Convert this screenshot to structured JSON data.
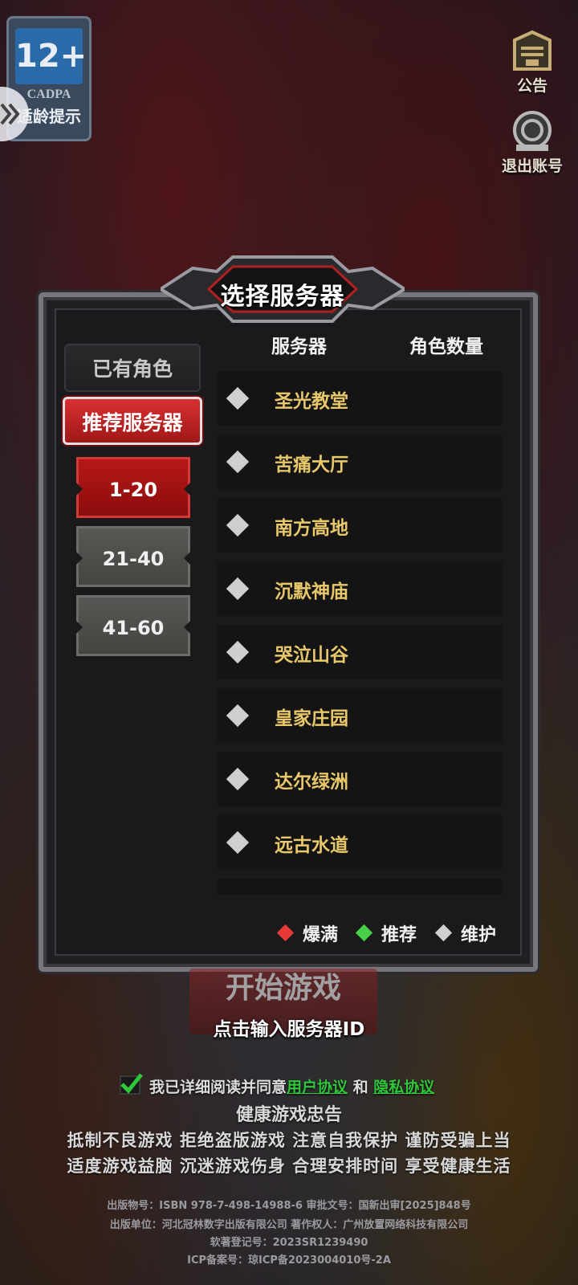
{
  "age_badge": {
    "rating": "12+",
    "org": "CADPA",
    "tip": "适龄提示"
  },
  "top_right": {
    "notice_label": "公告",
    "logout_label": "退出账号"
  },
  "dialog": {
    "title": "选择服务器",
    "columns": {
      "server": "服务器",
      "role_count": "角色数量"
    },
    "tabs": {
      "owned": "已有角色",
      "recommended": "推荐服务器"
    },
    "ranges": [
      {
        "label": "1-20",
        "active": true
      },
      {
        "label": "21-40",
        "active": false
      },
      {
        "label": "41-60",
        "active": false
      }
    ],
    "servers": [
      {
        "name": "圣光教堂",
        "status": "维护"
      },
      {
        "name": "苦痛大厅",
        "status": "维护"
      },
      {
        "name": "南方高地",
        "status": "维护"
      },
      {
        "name": "沉默神庙",
        "status": "维护"
      },
      {
        "name": "哭泣山谷",
        "status": "维护"
      },
      {
        "name": "皇家庄园",
        "status": "维护"
      },
      {
        "name": "达尔绿洲",
        "status": "维护"
      },
      {
        "name": "远古水道",
        "status": "维护"
      }
    ],
    "legend": {
      "full": "爆满",
      "recommended": "推荐",
      "maintenance": "维护"
    },
    "colors": {
      "full": "#e83838",
      "recommended": "#48d048",
      "maintenance": "#cfcfcf",
      "server_name": "#e8c86a"
    }
  },
  "start_button": "开始游戏",
  "server_id_prompt": "点击输入服务器ID",
  "agreement": {
    "prefix": "我已详细阅读并同意",
    "user_agreement": "用户协议",
    "and": "和",
    "privacy_policy": "隐私协议"
  },
  "health": {
    "title": "健康游戏忠告",
    "line1": "抵制不良游戏  拒绝盗版游戏  注意自我保护  谨防受骗上当",
    "line2": "适度游戏益脑  沉迷游戏伤身  合理安排时间  享受健康生活"
  },
  "legal": {
    "line1": "出版物号：ISBN 978-7-498-14988-6 审批文号：国新出审[2025]848号",
    "line2": "出版单位：河北冠林数字出版有限公司 著作权人：广州放置网络科技有限公司",
    "line3": "软著登记号：2023SR1239490",
    "line4": "ICP备案号：琼ICP备2023004010号-2A"
  }
}
